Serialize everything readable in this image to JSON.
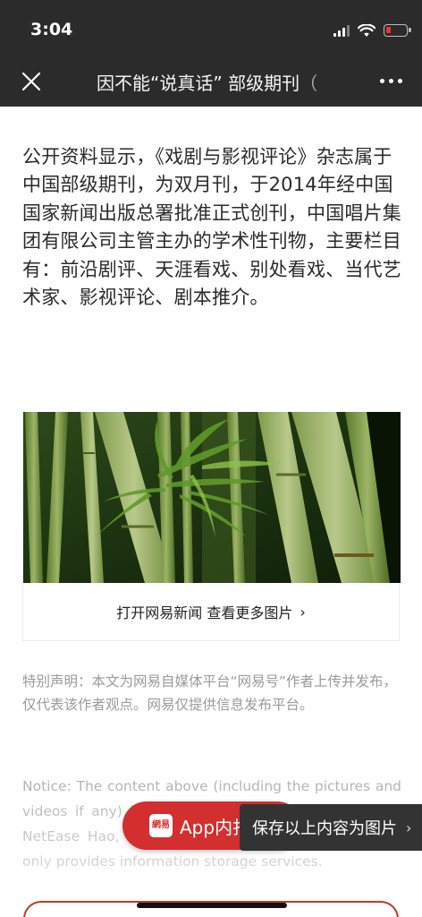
{
  "status_bar": {
    "time": "3:04"
  },
  "nav": {
    "title": "因不能“说真话” 部级期刊（",
    "close_icon": "close-icon",
    "more_icon": "more-dots-icon"
  },
  "article": {
    "paragraph": "公开资料显示，《戏剧与影视评论》杂志属于中国部级期刊，为双月刊，于2014年经中国国家新闻出版总署批准正式创刊，中国唱片集团有限公司主管主办的学术性刊物，主要栏目有：前沿剧评、天涯看戏、别处看戏、当代艺术家、影视评论、剧本推介。"
  },
  "image_card": {
    "caption": "打开网易新闻 查看更多图片",
    "chevron": "›"
  },
  "disclaimer": {
    "text": "特别声明：本文为网易自媒体平台“网易号”作者上传并发布，仅代表该作者观点。网易仅提供信息发布平台。"
  },
  "notice": {
    "text": "Notice: The content above (including the pictures and videos if any) is uploaded and posted by a user of NetEase Hao, which is a social media platform and only provides information storage services."
  },
  "floating": {
    "app_logo_text": "網易",
    "app_button_label": "App内打开",
    "save_button_label": "保存以上内容为图片",
    "save_chevron": "›"
  },
  "colors": {
    "topbar": "#2b2b2b",
    "brand_red": "#d32f2f",
    "save_bg": "#333333",
    "muted_text": "#9a9a9a"
  }
}
